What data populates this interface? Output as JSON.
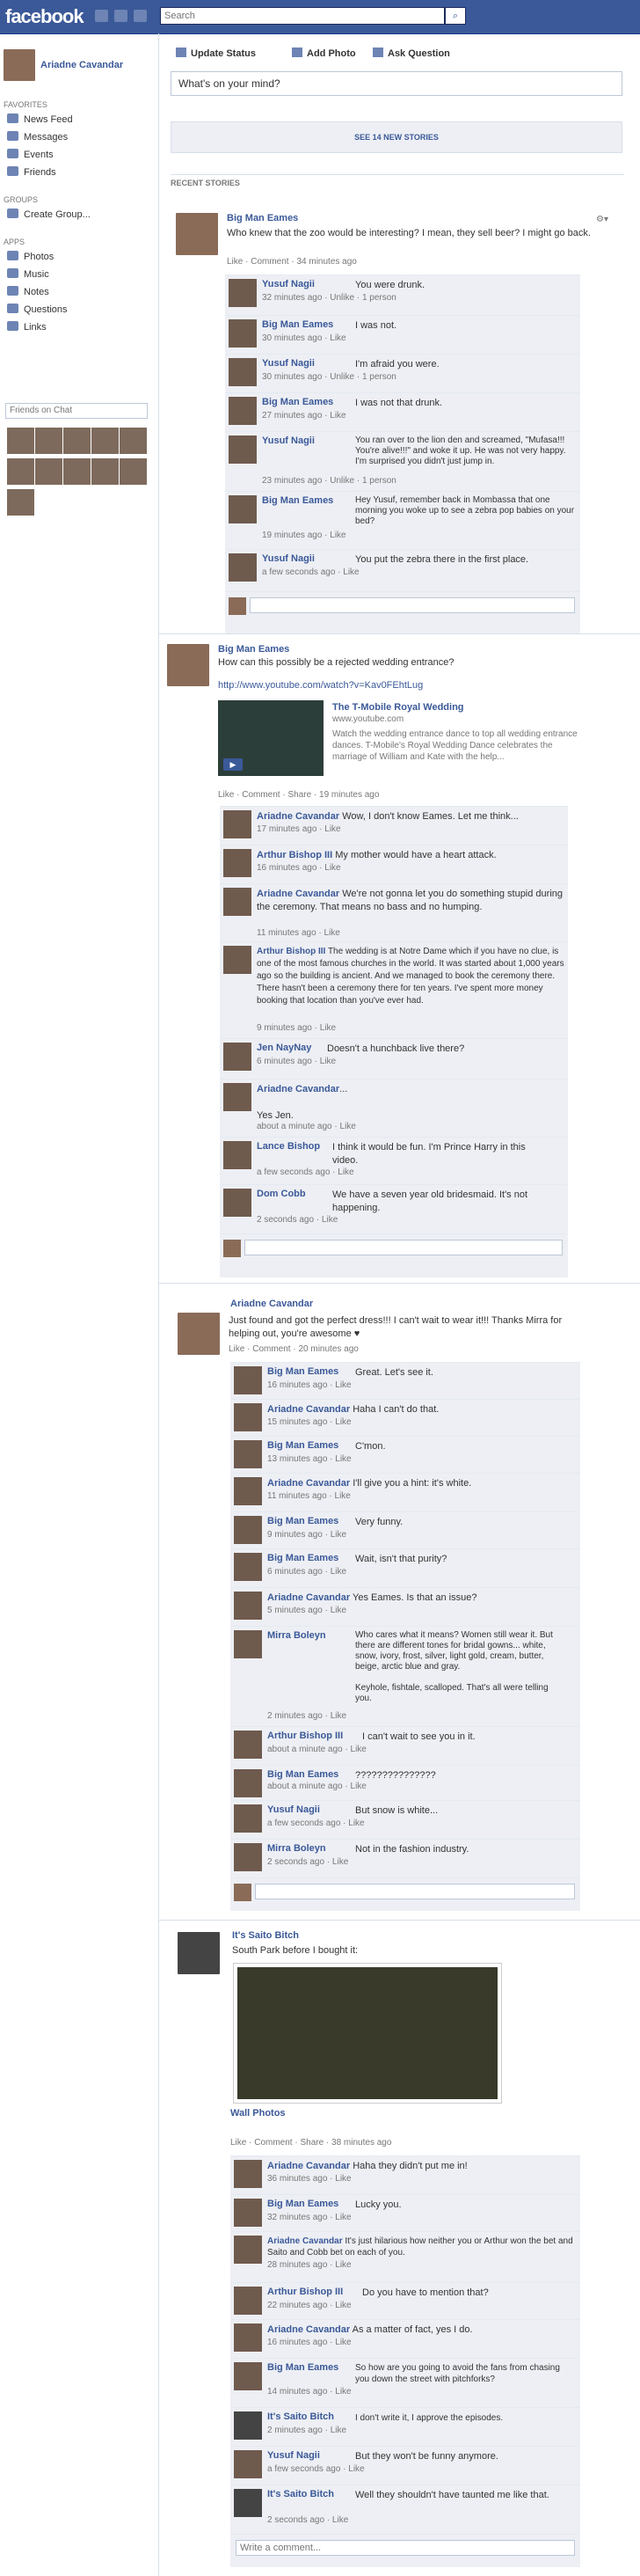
{
  "topbar": {
    "logo": "facebook",
    "search_placeholder": "Search",
    "search_button": "⌕"
  },
  "sidebar": {
    "profile_name": "Ariadne Cavandar",
    "favorites_title": "FAVORITES",
    "favorites": [
      "News Feed",
      "Messages",
      "Events",
      "Friends"
    ],
    "groups_title": "GROUPS",
    "groups": [
      "Create Group..."
    ],
    "apps_title": "APPS",
    "apps": [
      "Photos",
      "Music",
      "Notes",
      "Questions",
      "Links"
    ],
    "chat_placeholder": "Friends on Chat"
  },
  "composer": {
    "tabs": [
      "Update Status",
      "Add Photo",
      "Ask Question"
    ],
    "placeholder": "What's on your mind?",
    "new_stories": "SEE 14 NEW STORIES"
  },
  "feed": {
    "recent_title": "RECENT STORIES"
  },
  "posts": [
    {
      "author": "Big Man Eames",
      "text": "Who knew that the zoo would be interesting? I mean, they sell beer? I might go back.",
      "meta": "Like · Comment · 34 minutes ago",
      "comments": [
        {
          "name": "Yusuf Nagii",
          "text": "You were drunk.",
          "time": "32 minutes ago · Unlike · 1 person"
        },
        {
          "name": "Big Man Eames",
          "text": "I was not.",
          "time": "30 minutes ago · Like"
        },
        {
          "name": "Yusuf Nagii",
          "text": "I'm afraid you were.",
          "time": "30 minutes ago · Unlike · 1 person"
        },
        {
          "name": "Big Man Eames",
          "text": "I was not that drunk.",
          "time": "27 minutes ago · Like"
        },
        {
          "name": "Yusuf Nagii",
          "text": "You ran over to the lion den and screamed, \"Mufasa!!! You're alive!!!\" and woke it up. He was not very happy. I'm surprised you didn't just jump in.",
          "time": "23 minutes ago · Unlike · 1 person"
        },
        {
          "name": "Big Man Eames",
          "text": "Hey Yusuf, remember back in Mombassa that one morning you woke up to see a zebra pop babies on your bed?",
          "time": "19 minutes ago · Like"
        },
        {
          "name": "Yusuf Nagii",
          "text": "You put the zebra there in the first place.",
          "time": "a few seconds ago · Like"
        }
      ]
    },
    {
      "author": "Big Man Eames",
      "text": "How can this possibly be a rejected wedding entrance?",
      "url": "http://www.youtube.com/watch?v=Kav0FEhtLug",
      "link_title": "The T-Mobile Royal Wedding",
      "link_source": "www.youtube.com",
      "link_desc": "Watch the wedding entrance dance to top all wedding entrance dances. T-Mobile's Royal Wedding Dance celebrates the marriage of William and Kate with the help...",
      "meta": "Like · Comment · Share · 19 minutes ago",
      "comments": [
        {
          "name": "Ariadne Cavandar",
          "text": "Wow, I don't know Eames. Let me think...",
          "time": "17 minutes ago · Like"
        },
        {
          "name": "Arthur Bishop III",
          "text": "My mother would have a heart attack.",
          "time": "16 minutes ago · Like"
        },
        {
          "name": "Ariadne Cavandar",
          "text": "We're not gonna let you do something stupid during the ceremony. That means no bass and no humping.",
          "time": "11 minutes ago · Like"
        },
        {
          "name": "Arthur Bishop III",
          "text": "The wedding is at Notre Dame which if you have no clue, is one of the most famous churches in the world. It was started about 1,000 years ago so the building is ancient. And we managed to book the ceremony there. There hasn't been a ceremony there for ten years. I've spent more money booking that location than you've ever had.",
          "time": "9 minutes ago · Like"
        },
        {
          "name": "Jen NayNay",
          "text": "Doesn't a hunchback live there?",
          "time": "6 minutes ago · Like"
        },
        {
          "name": "Ariadne Cavandar",
          "text": "...\n\nYes Jen.",
          "time": "about a minute ago · Like"
        },
        {
          "name": "Lance Bishop",
          "text": "I think it would be fun. I'm Prince Harry in this video.",
          "time": "a few seconds ago · Like"
        },
        {
          "name": "Dom Cobb",
          "text": "We have a seven year old bridesmaid. It's not happening.",
          "time": "2 seconds ago · Like"
        }
      ]
    },
    {
      "author": "Ariadne Cavandar",
      "text": "Just found and got the perfect dress!!! I can't wait to wear it!!! Thanks Mirra for helping out, you're awesome ♥",
      "meta": "Like · Comment · 20 minutes ago",
      "comments": [
        {
          "name": "Big Man Eames",
          "text": "Great. Let's see it.",
          "time": "16 minutes ago · Like"
        },
        {
          "name": "Ariadne Cavandar",
          "text": "Haha I can't do that.",
          "time": "15 minutes ago · Like"
        },
        {
          "name": "Big Man Eames",
          "text": "C'mon.",
          "time": "13 minutes ago · Like"
        },
        {
          "name": "Ariadne Cavandar",
          "text": "I'll give you a hint: it's white.",
          "time": "11 minutes ago · Like"
        },
        {
          "name": "Big Man Eames",
          "text": "Very funny.",
          "time": "9 minutes ago · Like"
        },
        {
          "name": "Big Man Eames",
          "text": "Wait, isn't that purity?",
          "time": "6 minutes ago · Like"
        },
        {
          "name": "Ariadne Cavandar",
          "text": "Yes Eames. Is that an issue?",
          "time": "5 minutes ago · Like"
        },
        {
          "name": "Mirra Boleyn",
          "text": "Who cares what it means? Women still wear it. But there are different tones for bridal gowns... white, snow, ivory, frost, silver, light gold, cream, butter, beige, arctic blue and gray.\n\nKeyhole, fishtale, scalloped. That's all were telling you.",
          "time": "2 minutes ago · Like"
        },
        {
          "name": "Arthur Bishop III",
          "text": "I can't wait to see you in it.",
          "time": "about a minute ago · Like"
        },
        {
          "name": "Big Man Eames",
          "text": "???????????????",
          "time": "about a minute ago · Like"
        },
        {
          "name": "Yusuf Nagii",
          "text": "But snow is white...",
          "time": "a few seconds ago · Like"
        },
        {
          "name": "Mirra Boleyn",
          "text": "Not in the fashion industry.",
          "time": "2 seconds ago · Like"
        }
      ]
    },
    {
      "author": "It's Saito Bitch",
      "text": "South Park before I bought it:",
      "album": "Wall Photos",
      "meta": "Like · Comment · Share · 38 minutes ago",
      "comments": [
        {
          "name": "Ariadne Cavandar",
          "text": "Haha they didn't put me in!",
          "time": "36 minutes ago · Like"
        },
        {
          "name": "Big Man Eames",
          "text": "Lucky you.",
          "time": "32 minutes ago · Like"
        },
        {
          "name": "Ariadne Cavandar",
          "text": "It's just hilarious how neither you or Arthur won the bet and Saito and Cobb bet on each of you.",
          "time": "28 minutes ago · Like"
        },
        {
          "name": "Arthur Bishop III",
          "text": "Do you have to mention that?",
          "time": "22 minutes ago · Like"
        },
        {
          "name": "Ariadne Cavandar",
          "text": "As a matter of fact, yes I do.",
          "time": "16 minutes ago · Like"
        },
        {
          "name": "Big Man Eames",
          "text": "So how are you going to avoid the fans from chasing you down the street with pitchforks?",
          "time": "14 minutes ago · Like"
        },
        {
          "name": "It's Saito Bitch",
          "text": "I don't write it, I approve the episodes.",
          "time": "2 minutes ago · Like"
        },
        {
          "name": "Yusuf Nagii",
          "text": "But they won't be funny anymore.",
          "time": "a few seconds ago · Like"
        },
        {
          "name": "It's Saito Bitch",
          "text": "Well they shouldn't have taunted me like that.",
          "time": "2 seconds ago · Like"
        }
      ],
      "write_comment": "Write a comment..."
    }
  ]
}
